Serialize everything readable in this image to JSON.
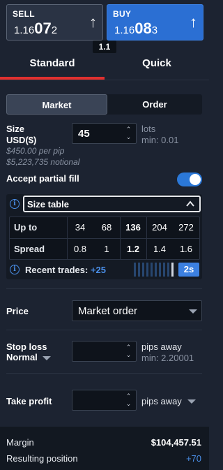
{
  "quotes": {
    "sell": {
      "label": "SELL",
      "price_prefix": "1.16",
      "price_main": "07",
      "price_suffix": "2"
    },
    "buy": {
      "label": "BUY",
      "price_prefix": "1.16",
      "price_main": "08",
      "price_suffix": "3"
    },
    "spread": "1.1",
    "arrow_icon": "up-arrow-icon"
  },
  "tabs": [
    {
      "label": "Standard",
      "active": true
    },
    {
      "label": "Quick",
      "active": false
    }
  ],
  "order_type": {
    "market_label": "Market",
    "order_label": "Order",
    "selected": "Market"
  },
  "size": {
    "label_line1": "Size",
    "label_line2": "USD($)",
    "value": "45",
    "unit": "lots",
    "min": "min: 0.01",
    "per_pip": "$450.00 per pip",
    "notional": "$5,223,735 notional"
  },
  "partial_fill": {
    "label": "Accept partial fill",
    "enabled": true
  },
  "size_table": {
    "select_label": "Size table",
    "rows": [
      {
        "header": "Up to",
        "values": [
          "34",
          "68",
          "136",
          "204",
          "272"
        ]
      },
      {
        "header": "Spread",
        "values": [
          "0.8",
          "1",
          "1.2",
          "1.4",
          "1.6"
        ]
      }
    ],
    "highlight_index": 2,
    "recent_label": "Recent trades:",
    "recent_value": "+25",
    "speed": "2s"
  },
  "price": {
    "label": "Price",
    "value": "Market order"
  },
  "stop_loss": {
    "label": "Stop loss",
    "mode": "Normal",
    "unit": "pips away",
    "min": "min: 2.20001"
  },
  "take_profit": {
    "label": "Take profit",
    "unit": "pips away"
  },
  "footer": {
    "margin_label": "Margin",
    "margin_value": "$104,457.51",
    "position_label": "Resulting position",
    "position_value": "+70"
  },
  "colors": {
    "accent": "#2b6fd3",
    "tab_underline": "#e0302f",
    "positive": "#4a8fe8"
  }
}
